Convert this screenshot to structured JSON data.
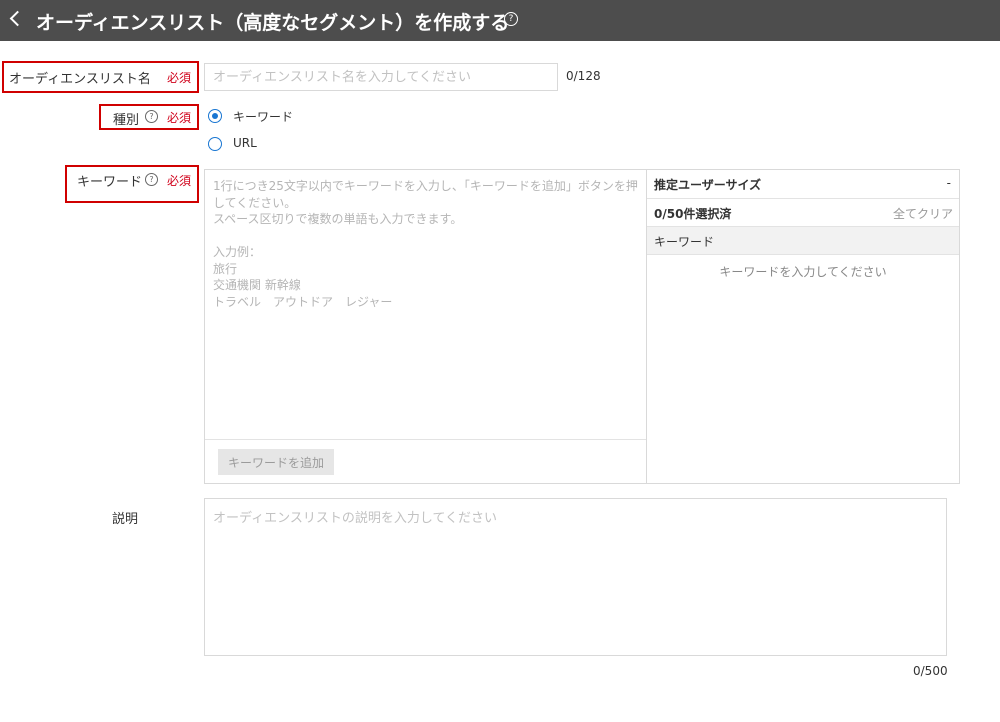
{
  "header": {
    "title": "オーディエンスリスト（高度なセグメント）を作成する",
    "help": "?"
  },
  "name_field": {
    "label": "オーディエンスリスト名",
    "required": "必須",
    "placeholder": "オーディエンスリスト名を入力してください",
    "value": "",
    "counter": "0/128"
  },
  "type_field": {
    "label": "種別",
    "help": "?",
    "required": "必須",
    "options": [
      {
        "label": "キーワード",
        "checked": true
      },
      {
        "label": "URL",
        "checked": false
      }
    ]
  },
  "keyword_field": {
    "label": "キーワード",
    "help": "?",
    "required": "必須",
    "placeholder_lines": "1行につき25文字以内でキーワードを入力し、「キーワードを追加」ボタンを押してください。\nスペース区切りで複数の単語も入力できます。\n\n入力例：\n旅行\n交通機関 新幹線\nトラベル　アウトドア　レジャー",
    "add_button": "キーワードを追加"
  },
  "side_panel": {
    "estimate_label": "推定ユーザーサイズ",
    "estimate_value": "-",
    "selected_count": "0/50件選択済",
    "clear_all": "全てクリア",
    "column_header": "キーワード",
    "empty_message": "キーワードを入力してください"
  },
  "description_field": {
    "label": "説明",
    "placeholder": "オーディエンスリストの説明を入力してください",
    "counter": "0/500"
  }
}
